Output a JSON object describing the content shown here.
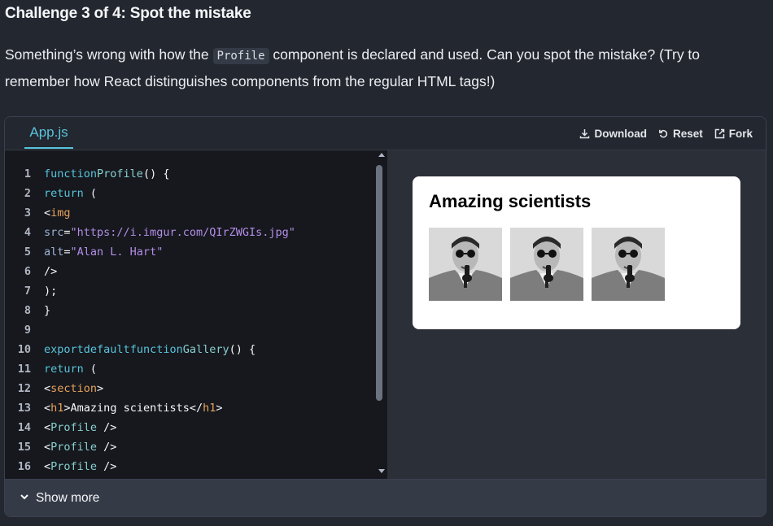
{
  "challenge": {
    "counter": "Challenge 3 of 4:",
    "name": "Spot the mistake",
    "desc_before": "Something’s wrong with how the ",
    "desc_code": "Profile",
    "desc_after": " component is declared and used. Can you spot the mistake? (Try to remember how React distinguishes components from the regular HTML tags!)"
  },
  "sandbox": {
    "tab_label": "App.js",
    "download_label": "Download",
    "reset_label": "Reset",
    "fork_label": "Fork",
    "show_more_label": "Show more"
  },
  "code": {
    "line_numbers": [
      "1",
      "2",
      "3",
      "4",
      "5",
      "6",
      "7",
      "8",
      "9",
      "10",
      "11",
      "12",
      "13",
      "14",
      "15",
      "16"
    ],
    "l1_kw": "function",
    "l1_fn": "Profile",
    "l1_rest": "() {",
    "l2_kw": "return",
    "l2_rest": " (",
    "l3_lt": "<",
    "l3_tag": "img",
    "l4_attr": "src",
    "l4_eq": "=",
    "l4_str": "\"https://i.imgur.com/QIrZWGIs.jpg\"",
    "l5_attr": "alt",
    "l5_eq": "=",
    "l5_str": "\"Alan L. Hart\"",
    "l6": "/>",
    "l7": ");",
    "l8": "}",
    "l10_kw1": "export",
    "l10_kw2": "default",
    "l10_kw3": "function",
    "l10_fn": "Gallery",
    "l10_rest": "() {",
    "l11_kw": "return",
    "l11_rest": " (",
    "l12_lt": "<",
    "l12_tag": "section",
    "l12_gt": ">",
    "l13_open_lt": "<",
    "l13_tag1": "h1",
    "l13_open_gt": ">",
    "l13_text": "Amazing scientists",
    "l13_close_lt": "</",
    "l13_tag2": "h1",
    "l13_close_gt": ">",
    "profile_lt": "<",
    "profile_tag": "Profile",
    "profile_end": " />"
  },
  "preview": {
    "heading": "Amazing scientists",
    "image_alt": "Alan L. Hart"
  },
  "colors": {
    "accent": "#58c4dc",
    "page_bg": "#23272f",
    "editor_bg": "#16181d"
  },
  "icons": [
    "download-icon",
    "reset-icon",
    "fork-icon",
    "chevron-down-icon"
  ]
}
